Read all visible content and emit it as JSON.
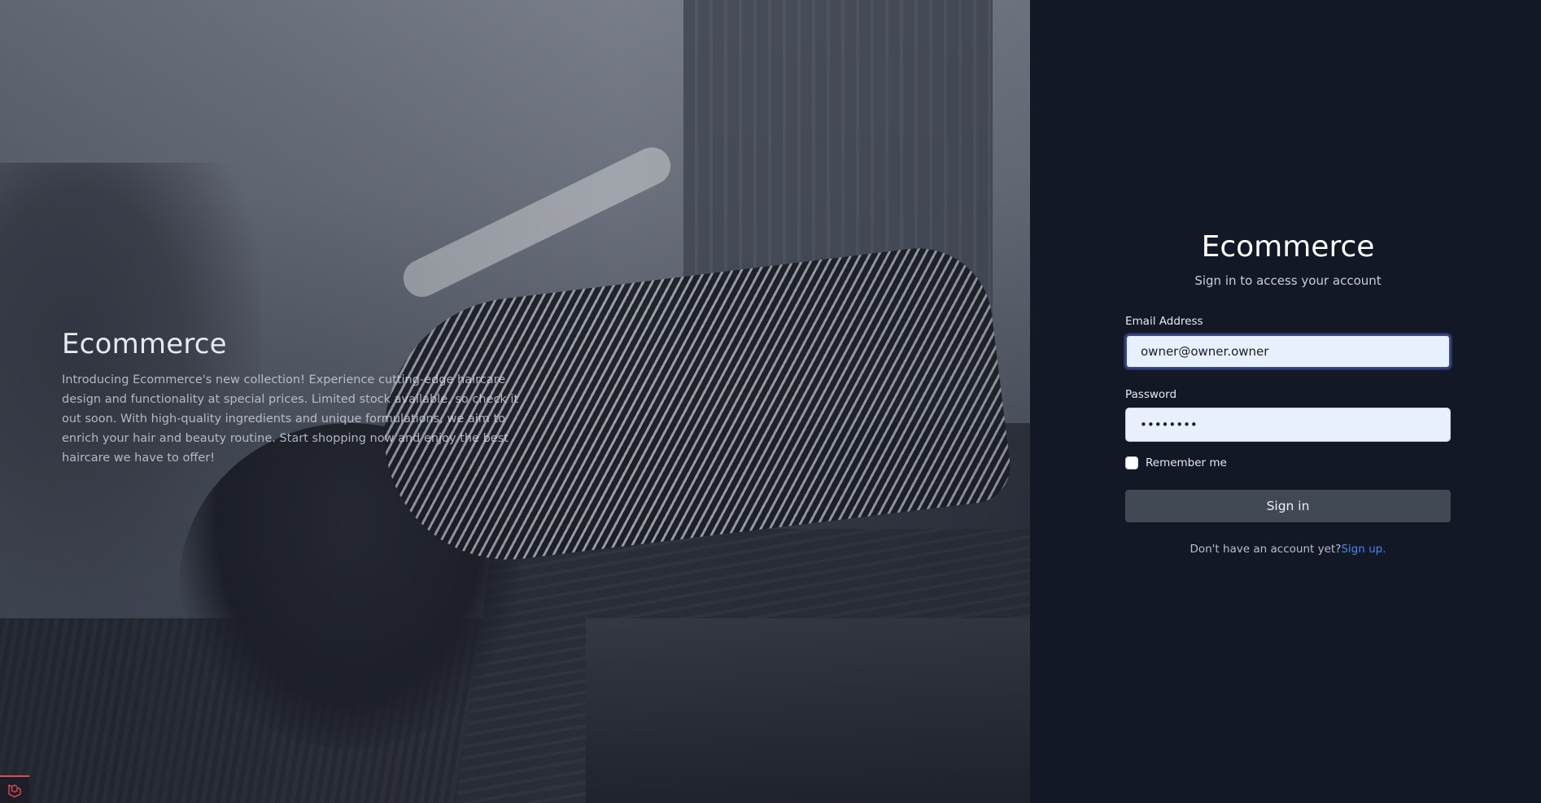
{
  "hero": {
    "title": "Ecommerce",
    "description": "Introducing Ecommerce's new collection! Experience cutting-edge haircare design and functionality at special prices. Limited stock available, so check it out soon. With high-quality ingredients and unique formulations, we aim to enrich your hair and beauty routine. Start shopping now and enjoy the best haircare we have to offer!",
    "image_description_icon": "hero-photo-woman-lying-on-bench"
  },
  "login": {
    "brand": "Ecommerce",
    "subtitle": "Sign in to access your account",
    "email_label": "Email Address",
    "email_value": "owner@owner.owner",
    "password_label": "Password",
    "password_value": "••••••••",
    "remember_label": "Remember me",
    "remember_checked": false,
    "submit_label": "Sign in",
    "signup_prompt": "Don't have an account yet?",
    "signup_link": "Sign up",
    "signup_suffix": "."
  },
  "badge": {
    "icon": "laravel-logo-icon"
  },
  "colors": {
    "panel_bg": "#121826",
    "input_bg": "#e8f0fe",
    "button_bg": "#414955",
    "link": "#4a86e8",
    "focus_ring": "#3b4a8a"
  }
}
